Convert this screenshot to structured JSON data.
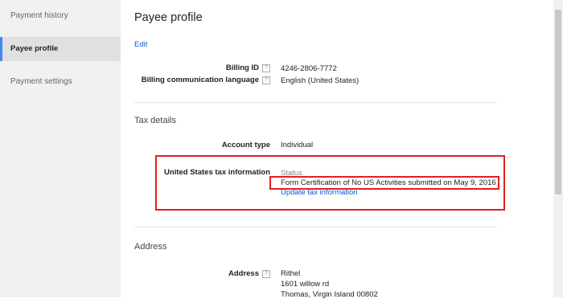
{
  "sidebar": {
    "items": [
      {
        "label": "Payment history"
      },
      {
        "label": "Payee profile"
      },
      {
        "label": "Payment settings"
      }
    ]
  },
  "page": {
    "title": "Payee profile",
    "edit_label": "Edit"
  },
  "billing": {
    "billing_id_label": "Billing ID",
    "billing_id_value": "4246-2806-7772",
    "language_label": "Billing communication language",
    "language_value": "English (United States)"
  },
  "tax": {
    "section_title": "Tax details",
    "account_type_label": "Account type",
    "account_type_value": "Individual",
    "us_tax_label": "United States tax information",
    "status_label": "Status",
    "status_value": "Form Certification of No US Activities submitted on May 9, 2016",
    "update_link": "Update tax information"
  },
  "address": {
    "section_title": "Address",
    "label": "Address",
    "lines": [
      "Rithel",
      "1601 willow rd",
      "Thomas, Virgin Island 00802"
    ]
  },
  "help_glyph": "?",
  "colors": {
    "link": "#1155cc",
    "highlight": "#e02020",
    "active_indicator": "#4285f4"
  }
}
